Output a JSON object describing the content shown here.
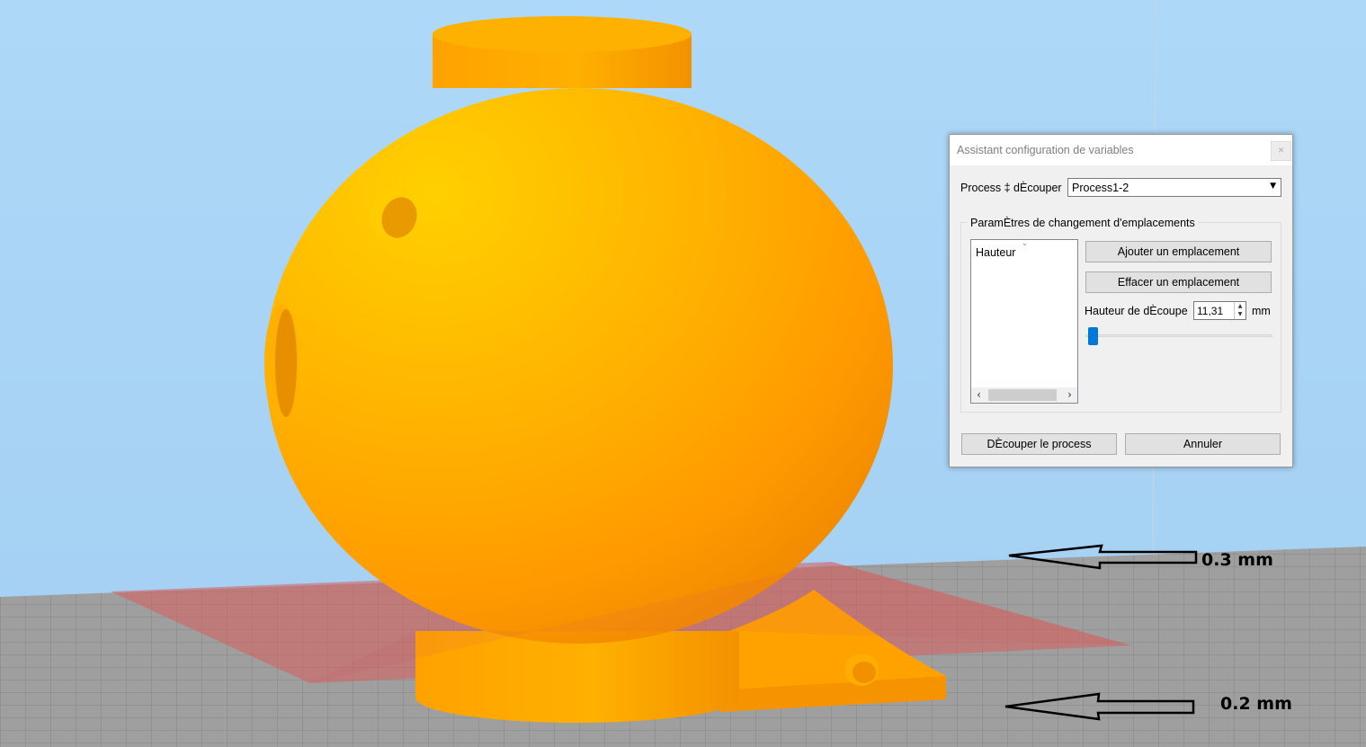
{
  "viewport": {
    "annotations": {
      "top_arrow_label": "0.3 mm",
      "bottom_arrow_label": "0.2 mm"
    },
    "colors": {
      "sky": "#a9d4f5",
      "bed": "#a4a4a4",
      "model": "#ff9d00",
      "cut_plane": "#d85b5b"
    }
  },
  "dialog": {
    "title": "Assistant configuration de variables",
    "close_icon": "close-icon",
    "process_label": "Process ‡ dÈcouper",
    "process_value": "Process1-2",
    "group_label": "ParamÈtres de changement d'emplacements",
    "list_items": [
      "Hauteur"
    ],
    "add_button": "Ajouter un emplacement",
    "delete_button": "Effacer un emplacement",
    "height_label": "Hauteur de dÈcoupe",
    "height_value": "11,31",
    "height_unit": "mm",
    "slider_level": 0.02,
    "split_button": "DÈcouper le process",
    "cancel_button": "Annuler",
    "accent_color": "#0078d7"
  }
}
